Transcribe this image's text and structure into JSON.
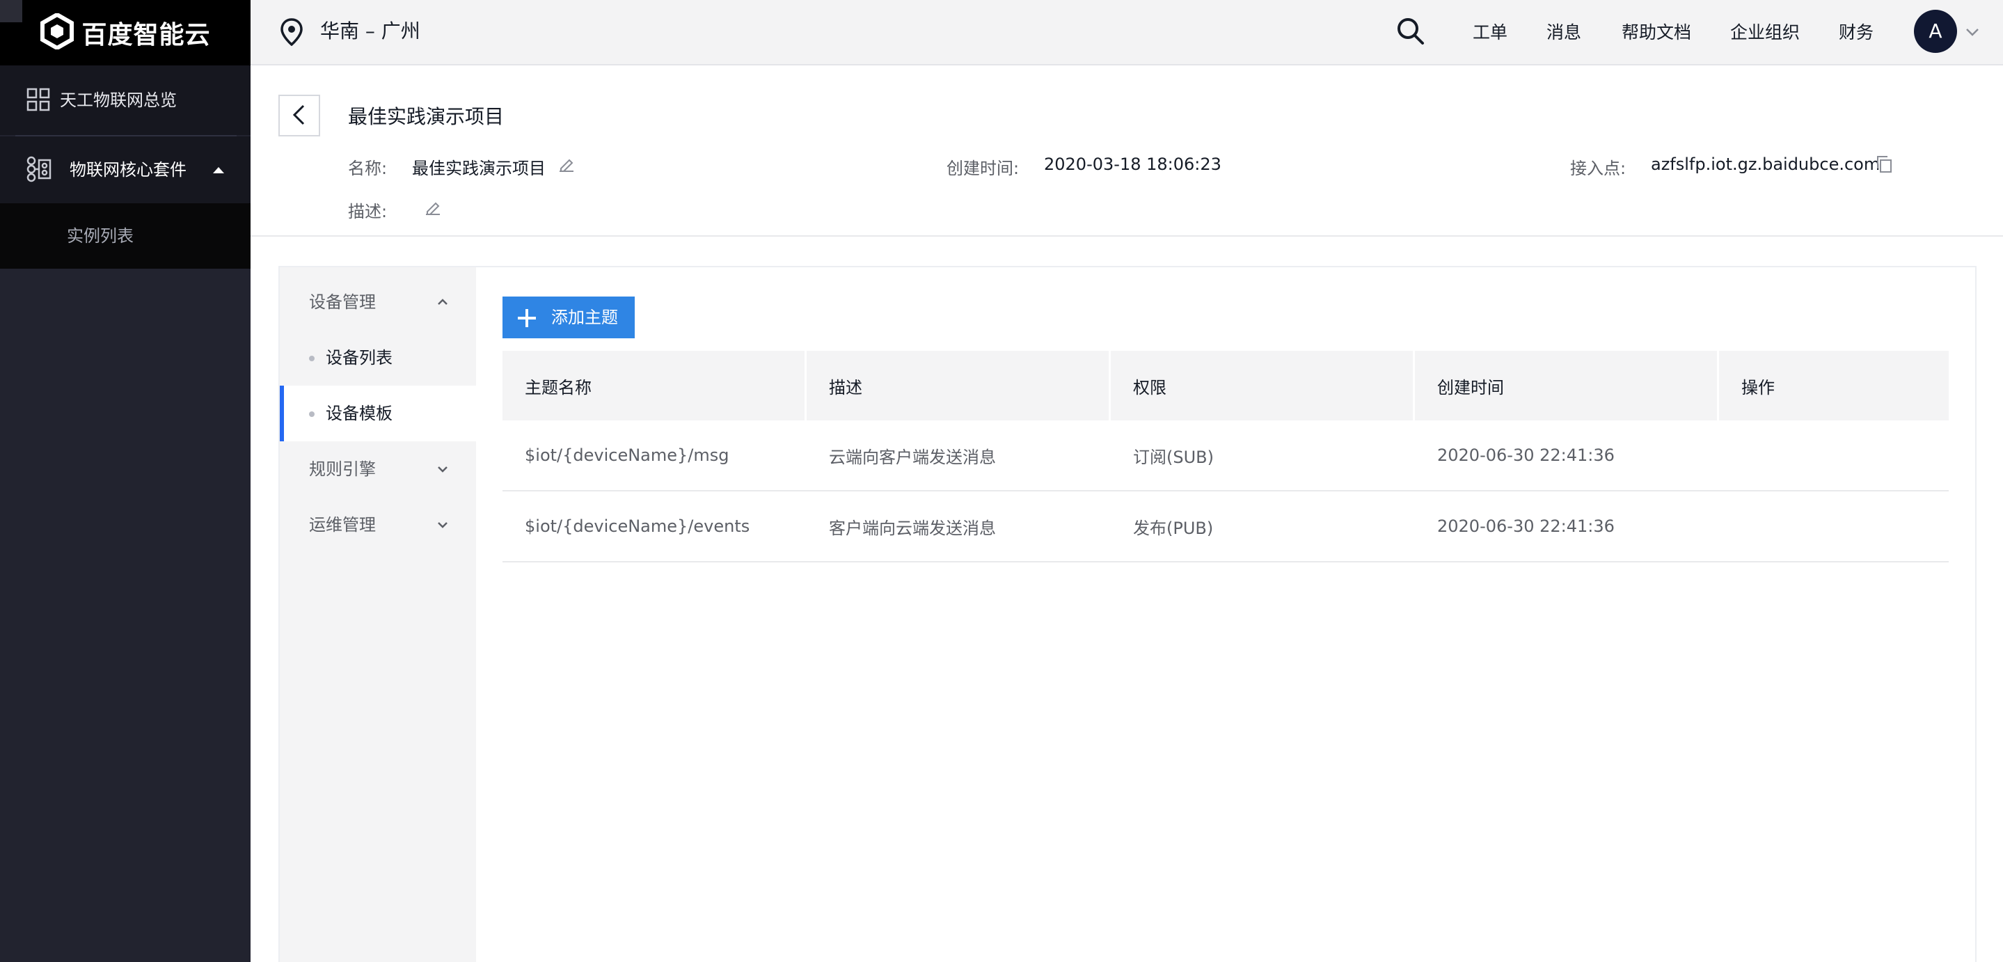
{
  "brand": {
    "logo_text": "百度智能云"
  },
  "sidebar": {
    "overview_label": "天工物联网总览",
    "core_label": "物联网核心套件",
    "sub_items": [
      "实例列表"
    ]
  },
  "topbar": {
    "region": "华南 – 广州",
    "menu": [
      "工单",
      "消息",
      "帮助文档",
      "企业组织",
      "财务"
    ],
    "avatar_letter": "A"
  },
  "header": {
    "title": "最佳实践演示项目",
    "name_label": "名称:",
    "name_value": "最佳实践演示项目",
    "created_label": "创建时间:",
    "created_value": "2020-03-18 18:06:23",
    "endpoint_label": "接入点:",
    "endpoint_value": "azfslfp.iot.gz.baidubce.com",
    "desc_label": "描述:"
  },
  "subnav": {
    "device_mgmt": "设备管理",
    "device_list": "设备列表",
    "device_template": "设备模板",
    "rule_engine": "规则引擎",
    "ops_mgmt": "运维管理"
  },
  "main": {
    "add_button": "添加主题",
    "columns": [
      "主题名称",
      "描述",
      "权限",
      "创建时间",
      "操作"
    ],
    "rows": [
      [
        "$iot/{deviceName}/msg",
        "云端向客户端发送消息",
        "订阅(SUB)",
        "2020-06-30 22:41:36",
        ""
      ],
      [
        "$iot/{deviceName}/events",
        "客户端向云端发送消息",
        "发布(PUB)",
        "2020-06-30 22:41:36",
        ""
      ]
    ]
  },
  "colors": {
    "accent": "#2f85e4",
    "sidebar_bg": "#22232f",
    "active_bar": "#2468f2"
  },
  "icons": [
    "logo-icon",
    "grid-icon",
    "iot-core-icon",
    "chevron-up-icon",
    "location-pin-icon",
    "search-icon",
    "chevron-down-icon",
    "back-arrow-icon",
    "edit-icon",
    "copy-icon",
    "plus-icon"
  ]
}
